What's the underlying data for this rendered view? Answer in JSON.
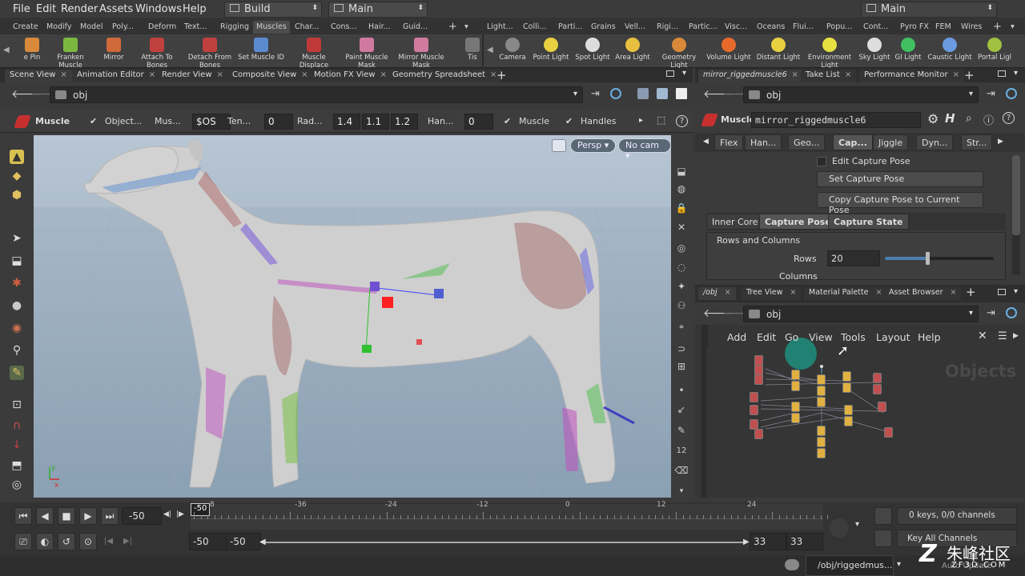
{
  "menubar": {
    "items": [
      "File",
      "Edit",
      "Render",
      "Assets",
      "Windows",
      "Help"
    ],
    "build": "Build",
    "main_desktop": "Main",
    "right_desktop": "Main"
  },
  "shelf_tabs_left": [
    "Create",
    "Modify",
    "Model",
    "Poly...",
    "Deform",
    "Text...",
    "Rigging",
    "Muscles",
    "Char...",
    "Cons...",
    "Hair...",
    "Guid..."
  ],
  "shelf_tabs_right": [
    "Light...",
    "Colli...",
    "Parti...",
    "Grains",
    "Vell...",
    "Rigi...",
    "Partic...",
    "Visc...",
    "Oceans",
    "Flui...",
    "Popu...",
    "Cont...",
    "Pyro FX",
    "FEM",
    "Wires"
  ],
  "shelf_tools_left": [
    {
      "label": "e Pin",
      "color": "#d88a3a"
    },
    {
      "label": "Franken Muscle",
      "color": "#7ab840"
    },
    {
      "label": "Mirror",
      "color": "#d06a3a"
    },
    {
      "label": "Attach To Bones",
      "color": "#c04040"
    },
    {
      "label": "Detach From Bones",
      "color": "#c04040"
    },
    {
      "label": "Set Muscle ID",
      "color": "#5a8ad0"
    },
    {
      "label": "Muscle Displace",
      "color": "#c03a3a"
    },
    {
      "label": "Paint Muscle Mask",
      "color": "#d07aa0"
    },
    {
      "label": "Mirror Muscle Mask",
      "color": "#d07aa0"
    },
    {
      "label": "Tis",
      "color": "#777"
    }
  ],
  "shelf_tools_right": [
    {
      "label": "Camera",
      "color": "#888"
    },
    {
      "label": "Point Light",
      "color": "#e8d040"
    },
    {
      "label": "Spot Light",
      "color": "#ddd"
    },
    {
      "label": "Area Light",
      "color": "#e8c040"
    },
    {
      "label": "Geometry Light",
      "color": "#d88a3a"
    },
    {
      "label": "Volume Light",
      "color": "#e86a2a"
    },
    {
      "label": "Distant Light",
      "color": "#e8d040"
    },
    {
      "label": "Environment Light",
      "color": "#e8e040"
    },
    {
      "label": "Sky Light",
      "color": "#ddd"
    },
    {
      "label": "GI Light",
      "color": "#40c060"
    },
    {
      "label": "Caustic Light",
      "color": "#6a9ae0"
    },
    {
      "label": "Portal Ligl",
      "color": "#a0c040"
    }
  ],
  "left_pane_tabs": [
    "Scene View",
    "Animation Editor",
    "Render View",
    "Composite View",
    "Motion FX View",
    "Geometry Spreadsheet"
  ],
  "left_path": "obj",
  "op_toolbar": {
    "tool_name": "Muscle",
    "object_label": "Object...",
    "mus_label": "Mus...",
    "mus_value": "$OS",
    "ten_label": "Ten...",
    "ten_value": "0",
    "rad_label": "Rad...",
    "rad_values": [
      "1.4",
      "1.1",
      "1.2"
    ],
    "han_label": "Han...",
    "han_value": "0",
    "muscle_check": "Muscle",
    "handles_check": "Handles"
  },
  "viewport": {
    "persp": "Persp",
    "cam": "No cam"
  },
  "right_pane_tabs": [
    "mirror_riggedmuscle6",
    "Take List",
    "Performance Monitor"
  ],
  "right_path": "obj",
  "param": {
    "type": "Muscle",
    "name": "mirror_riggedmuscle6",
    "tabs": [
      "Flex",
      "Han...",
      "Geo...",
      "Cap...",
      "Jiggle",
      "Dyn...",
      "Str..."
    ],
    "edit_capture_pose": "Edit Capture Pose",
    "set_capture_pose": "Set Capture Pose",
    "copy_capture_pose": "Copy Capture Pose to Current Pose",
    "sub_tabs": [
      "Inner Core",
      "Capture Pose",
      "Capture State"
    ],
    "rows_cols": "Rows and Columns",
    "rows_label": "Rows",
    "rows_value": "20",
    "rows_fraction": 0.39,
    "columns_label": "Columns"
  },
  "network_tabs": [
    "/obj",
    "Tree View",
    "Material Palette",
    "Asset Browser"
  ],
  "network_path": "obj",
  "network_menu": [
    "Add",
    "Edit",
    "Go",
    "View",
    "Tools",
    "Layout",
    "Help"
  ],
  "network_watermark": "Objects",
  "timeline": {
    "current_frame": "-50",
    "marker": "-50",
    "ticks": [
      "8",
      "-36",
      "-24",
      "-12",
      "0",
      "12",
      "24"
    ],
    "start1": "-50",
    "start2": "-50",
    "end1": "33",
    "end2": "33",
    "keys_info": "0 keys, 0/0 channels",
    "key_all": "Key All Channels"
  },
  "status": {
    "path": "/obj/riggedmus...",
    "auto_update": "Auto Update"
  },
  "watermark": {
    "cn": "朱峰社区",
    "url": "ZF3D.COM"
  }
}
